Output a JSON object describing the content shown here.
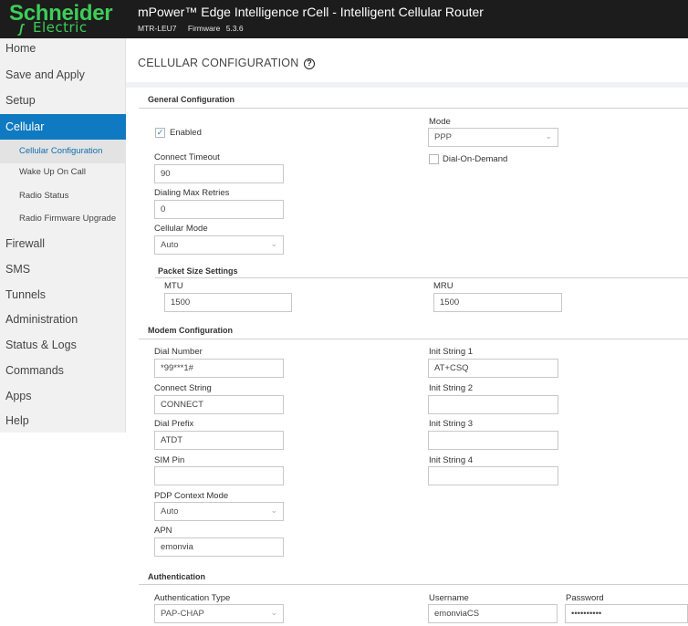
{
  "header": {
    "logo_top": "Schneider",
    "logo_bottom": "Electric",
    "title": "mPower™ Edge Intelligence rCell - Intelligent Cellular Router",
    "model": "MTR-LEU7",
    "firmware_label": "Firmware",
    "firmware_version": "5.3.6"
  },
  "sidebar": {
    "items": [
      {
        "label": "Home"
      },
      {
        "label": "Save and Apply"
      },
      {
        "label": "Setup"
      },
      {
        "label": "Cellular"
      },
      {
        "label": "Firewall"
      },
      {
        "label": "SMS"
      },
      {
        "label": "Tunnels"
      },
      {
        "label": "Administration"
      },
      {
        "label": "Status & Logs"
      },
      {
        "label": "Commands"
      },
      {
        "label": "Apps"
      },
      {
        "label": "Help"
      }
    ],
    "sub_items": [
      {
        "label": "Cellular Configuration"
      },
      {
        "label": "Wake Up On Call"
      },
      {
        "label": "Radio Status"
      },
      {
        "label": "Radio Firmware Upgrade"
      }
    ],
    "active_color": "#0f7ac2"
  },
  "page": {
    "title": "CELLULAR CONFIGURATION",
    "help_glyph": "?"
  },
  "general": {
    "heading": "General Configuration",
    "enabled_label": "Enabled",
    "enabled_checked": true,
    "connect_timeout_label": "Connect Timeout",
    "connect_timeout_value": "90",
    "dialing_max_retries_label": "Dialing Max Retries",
    "dialing_max_retries_value": "0",
    "cellular_mode_label": "Cellular Mode",
    "cellular_mode_value": "Auto",
    "mode_label": "Mode",
    "mode_value": "PPP",
    "dial_on_demand_label": "Dial-On-Demand",
    "dial_on_demand_checked": false
  },
  "packet": {
    "heading": "Packet Size Settings",
    "mtu_label": "MTU",
    "mtu_value": "1500",
    "mru_label": "MRU",
    "mru_value": "1500"
  },
  "modem": {
    "heading": "Modem Configuration",
    "dial_number_label": "Dial Number",
    "dial_number_value": "*99***1#",
    "connect_string_label": "Connect String",
    "connect_string_value": "CONNECT",
    "dial_prefix_label": "Dial Prefix",
    "dial_prefix_value": "ATDT",
    "sim_pin_label": "SIM Pin",
    "sim_pin_value": "",
    "pdp_context_mode_label": "PDP Context Mode",
    "pdp_context_mode_value": "Auto",
    "apn_label": "APN",
    "apn_value": "emonvia",
    "init1_label": "Init String 1",
    "init1_value": "AT+CSQ",
    "init2_label": "Init String 2",
    "init2_value": "",
    "init3_label": "Init String 3",
    "init3_value": "",
    "init4_label": "Init String 4",
    "init4_value": ""
  },
  "auth": {
    "heading": "Authentication",
    "type_label": "Authentication Type",
    "type_value": "PAP-CHAP",
    "username_label": "Username",
    "username_value": "emonviaCS",
    "password_label": "Password",
    "password_value": "••••••••••"
  },
  "icons": {
    "chevron": "chevron-down-icon",
    "check": "check-icon",
    "help": "help-circle-icon"
  }
}
